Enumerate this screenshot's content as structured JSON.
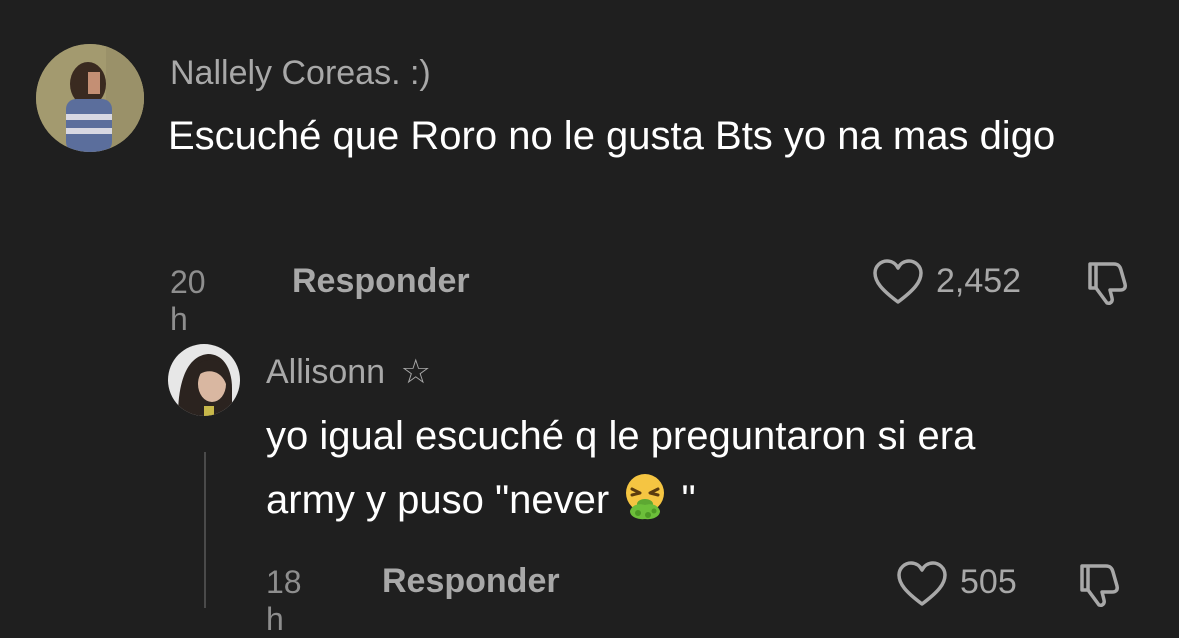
{
  "comments": [
    {
      "username": "Nallely Coreas. :)",
      "text": "Escuché que Roro no le gusta Bts yo na mas digo",
      "time": "20 h",
      "reply_label": "Responder",
      "likes": "2,452"
    }
  ],
  "reply": {
    "username": "Allisonn",
    "username_suffix": "☆",
    "text_line1": "yo igual escuché q le preguntaron si era",
    "text_line2_before": "army y puso \"never ",
    "text_line2_after": " \"",
    "emoji": "vomiting-face",
    "time": "18 h",
    "reply_label": "Responder",
    "likes": "505"
  },
  "colors": {
    "background": "#1f1f1f",
    "primary_text": "#ffffff",
    "secondary_text": "#a8a8a8",
    "muted_text": "#8e8e8e"
  }
}
